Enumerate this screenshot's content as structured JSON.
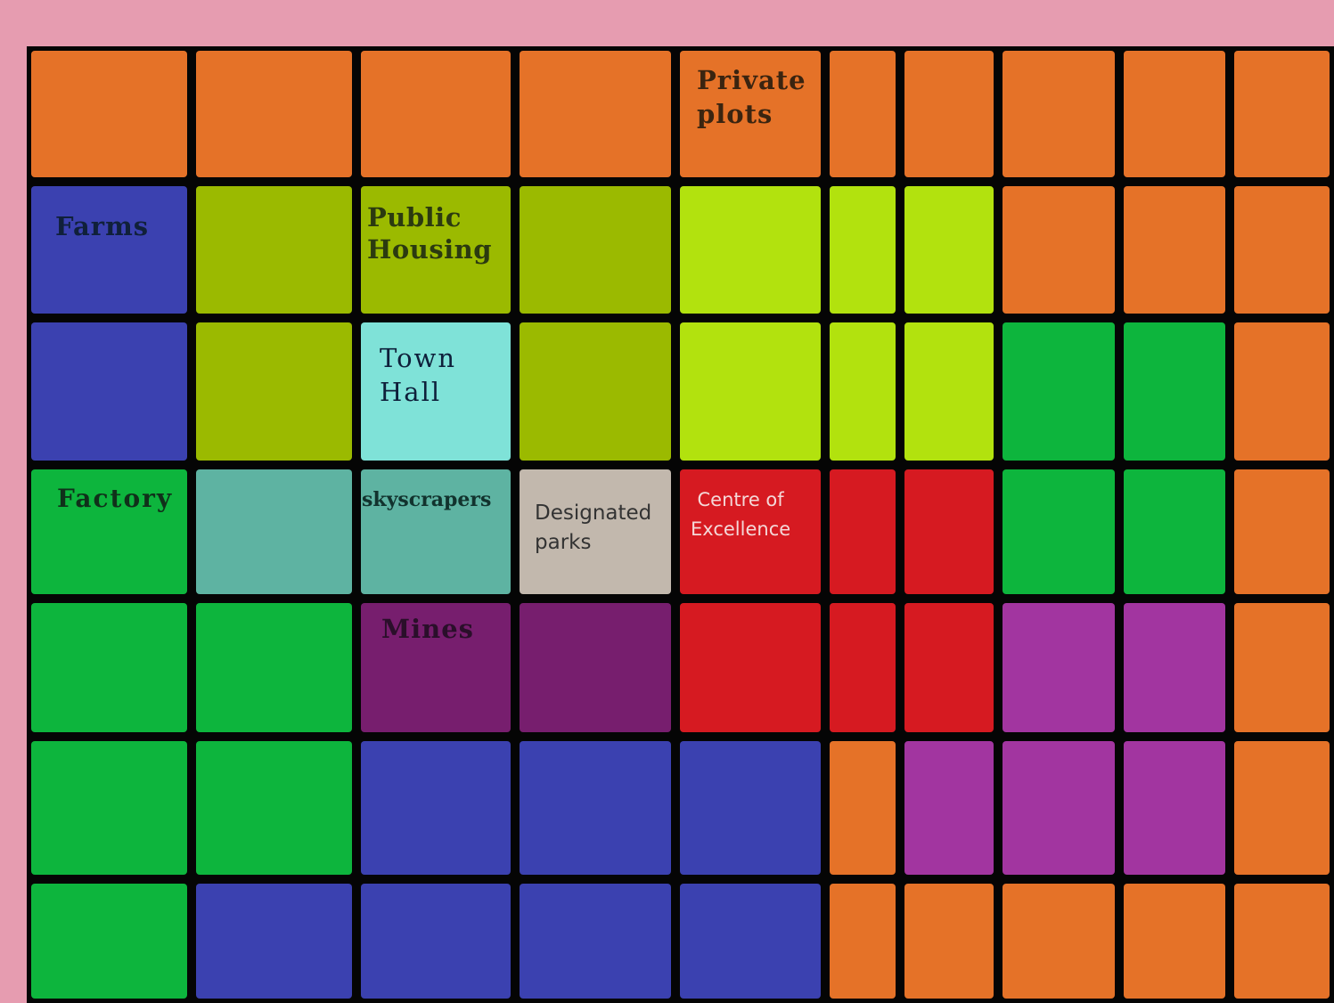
{
  "palette": {
    "orange": "#e57228",
    "blue": "#3b41b0",
    "olive": "#9bba00",
    "lime": "#b2e20e",
    "cyan": "#7fe2d8",
    "teal": "#5eb3a2",
    "beige": "#c2b8ad",
    "green": "#0db53d",
    "red": "#d61a21",
    "purple": "#771e6e",
    "magenta": "#a235a0"
  },
  "grid": [
    [
      "orange",
      "orange",
      "orange",
      "orange",
      "orange",
      "orange",
      "orange",
      "orange",
      "orange",
      "orange",
      "orange"
    ],
    [
      "blue",
      "olive",
      "olive",
      "olive",
      "lime",
      "lime",
      "lime",
      "orange",
      "orange",
      "orange",
      "orange"
    ],
    [
      "blue",
      "olive",
      "cyan",
      "olive",
      "lime",
      "lime",
      "lime",
      "green",
      "green",
      "orange",
      "orange"
    ],
    [
      "green",
      "teal",
      "teal",
      "beige",
      "red",
      "red",
      "red",
      "green",
      "green",
      "orange",
      "orange"
    ],
    [
      "green",
      "green",
      "purple",
      "purple",
      "red",
      "red",
      "red",
      "magenta",
      "magenta",
      "orange",
      "orange"
    ],
    [
      "green",
      "green",
      "blue",
      "blue",
      "blue",
      "orange",
      "magenta",
      "magenta",
      "magenta",
      "orange",
      "orange"
    ],
    [
      "green",
      "blue",
      "blue",
      "blue",
      "blue",
      "orange",
      "orange",
      "orange",
      "orange",
      "orange",
      "orange"
    ]
  ],
  "zones": [
    {
      "name": "private-plots-label",
      "text": "Private\nplots"
    },
    {
      "name": "farms-label",
      "text": "Farms"
    },
    {
      "name": "public-housing-label",
      "text": "Public\nHousing"
    },
    {
      "name": "town-hall-label",
      "text": "Town\nHall"
    },
    {
      "name": "factory-label",
      "text": "Factory"
    },
    {
      "name": "skyscrapers-label",
      "text": "skyscrapers"
    },
    {
      "name": "designated-parks-label",
      "text": "Designated\nparks"
    },
    {
      "name": "centre-of-excellence-label",
      "text": "Centre of\nExcellence"
    },
    {
      "name": "mines-label",
      "text": "Mines"
    }
  ]
}
